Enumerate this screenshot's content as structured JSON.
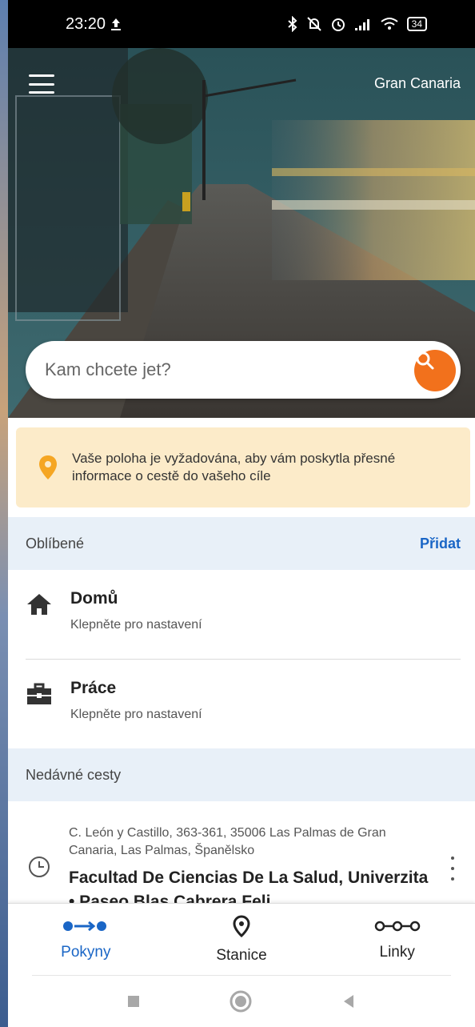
{
  "status_bar": {
    "time": "23:20",
    "battery": "34"
  },
  "header": {
    "region": "Gran Canaria"
  },
  "search": {
    "placeholder": "Kam chcete jet?"
  },
  "notice": {
    "text": "Vaše poloha je vyžadována, aby vám poskytla přesné informace o cestě do vašeho cíle"
  },
  "favorites": {
    "title": "Oblíbené",
    "add_label": "Přidat",
    "items": [
      {
        "title": "Domů",
        "subtitle": "Klepněte pro nastavení",
        "icon": "home-icon"
      },
      {
        "title": "Práce",
        "subtitle": "Klepněte pro nastavení",
        "icon": "briefcase-icon"
      }
    ]
  },
  "recent": {
    "title": "Nedávné cesty",
    "items": [
      {
        "address": "C. León y Castillo, 363-361, 35006 Las Palmas de Gran Canaria, Las Palmas, Španělsko",
        "destination": "Facultad De Ciencias De La Salud, Univerzita • Paseo Blas Cabrera Feli"
      }
    ]
  },
  "bottom_nav": {
    "items": [
      {
        "label": "Pokyny",
        "icon": "directions-icon",
        "active": true
      },
      {
        "label": "Stanice",
        "icon": "location-pin-icon",
        "active": false
      },
      {
        "label": "Linky",
        "icon": "route-lines-icon",
        "active": false
      }
    ]
  },
  "colors": {
    "accent": "#f2711c",
    "link": "#1a66c6",
    "notice_bg": "#fcebc9",
    "section_bg": "#e8f0f8"
  }
}
